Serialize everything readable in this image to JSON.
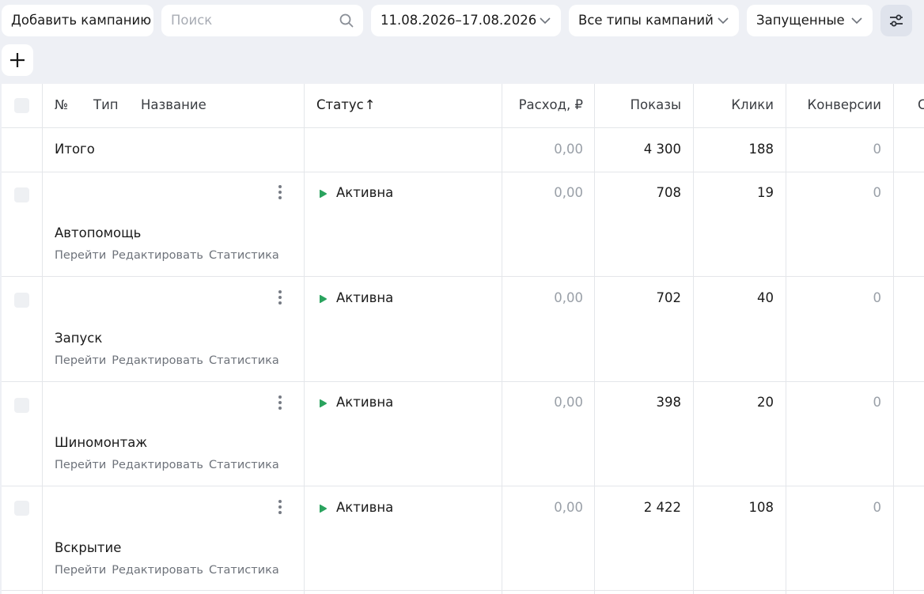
{
  "toolbar": {
    "add_campaign_label": "Добавить кампанию",
    "search_placeholder": "Поиск",
    "date_range": "11.08.2026–17.08.2026",
    "campaign_types": "Все типы кампаний",
    "campaign_state": "Запущенные"
  },
  "table": {
    "headers": {
      "number": "№",
      "type": "Тип",
      "name": "Название",
      "status": "Статус",
      "status_sort": "↑",
      "spend": "Расход, ₽",
      "impressions": "Показы",
      "clicks": "Клики",
      "conversions": "Конверсии",
      "cut_off_next": "С"
    },
    "total": {
      "label": "Итого",
      "spend": "0,00",
      "impressions": "4 300",
      "clicks": "188",
      "conversions": "0"
    },
    "row_links": {
      "open": "Перейти",
      "edit": "Редактировать",
      "stats": "Статистика"
    },
    "rows": [
      {
        "name": "Автопомощь",
        "status": "Активна",
        "spend": "0,00",
        "impressions": "708",
        "clicks": "19",
        "conversions": "0"
      },
      {
        "name": "Запуск",
        "status": "Активна",
        "spend": "0,00",
        "impressions": "702",
        "clicks": "40",
        "conversions": "0"
      },
      {
        "name": "Шиномонтаж",
        "status": "Активна",
        "spend": "0,00",
        "impressions": "398",
        "clicks": "20",
        "conversions": "0"
      },
      {
        "name": "Вскрытие",
        "status": "Активна",
        "spend": "0,00",
        "impressions": "2 422",
        "clicks": "108",
        "conversions": "0"
      }
    ]
  },
  "colors": {
    "background": "#eef0f5",
    "status_active": "#2aa35e",
    "muted_text": "#9aa0a8",
    "filter_button_bg": "#dfe3ec"
  },
  "icons": {
    "search": "search-icon",
    "dropdown": "chevron-down-icon",
    "filter": "filter-sliders-icon",
    "add": "plus-icon",
    "row_menu": "more-vertical-icon",
    "status": "play-icon"
  }
}
